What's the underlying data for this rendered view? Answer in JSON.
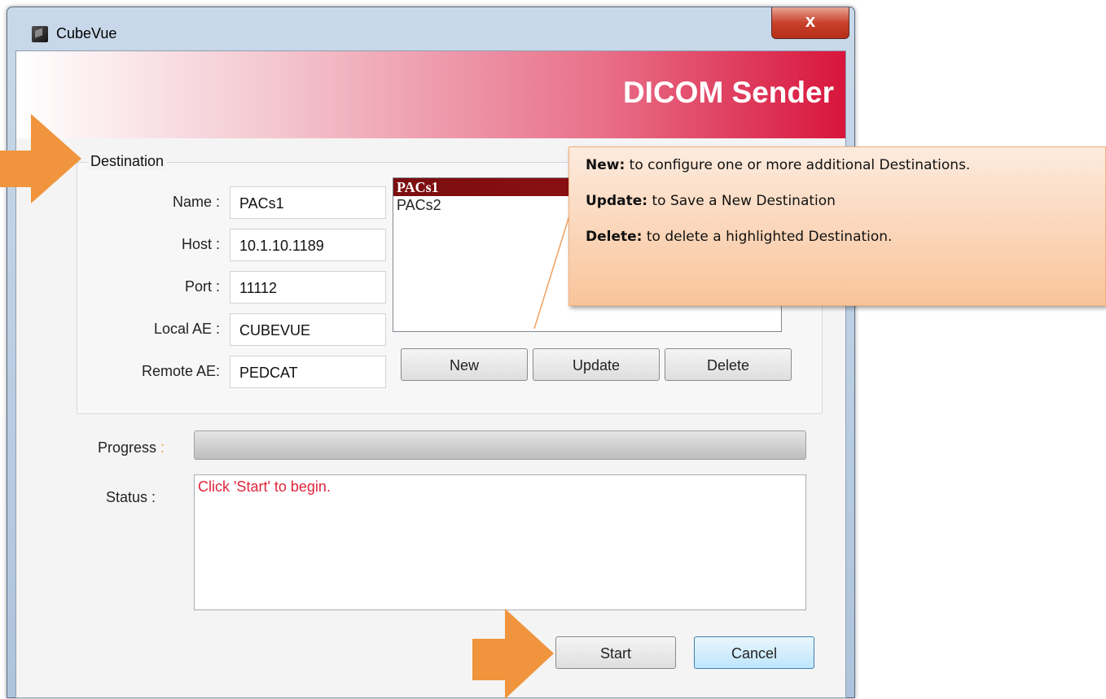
{
  "window": {
    "title": "CubeVue",
    "close_glyph": "x"
  },
  "banner": {
    "title": "DICOM Sender"
  },
  "destination": {
    "legend": "Destination",
    "fields": [
      {
        "label": "Name :",
        "value": "PACs1"
      },
      {
        "label": "Host :",
        "value": "10.1.10.1189"
      },
      {
        "label": "Port :",
        "value": "11112"
      },
      {
        "label": "Local AE :",
        "value": "CUBEVUE"
      },
      {
        "label": "Remote AE:",
        "value": "PEDCAT"
      }
    ],
    "list": [
      "PACs1",
      "PACs2"
    ],
    "selected": "PACs1",
    "buttons": {
      "new": "New",
      "update": "Update",
      "delete": "Delete"
    }
  },
  "progress": {
    "label": "Progress",
    "colon": " :",
    "value": 0
  },
  "status": {
    "label": "Status :",
    "text": "Click 'Start' to begin."
  },
  "actions": {
    "start": "Start",
    "cancel": "Cancel"
  },
  "callout": {
    "lines": [
      {
        "key": "New:",
        "text": " to configure one or more additional Destinations."
      },
      {
        "key": "Update:",
        "text": "  to Save a New Destination"
      },
      {
        "key": "Delete:",
        "text": "  to delete a highlighted Destination."
      }
    ]
  },
  "colors": {
    "banner_accent": "#d8153c",
    "arrow": "#f0953d",
    "status_text": "#e0243c",
    "selected_row": "#8b1012"
  }
}
